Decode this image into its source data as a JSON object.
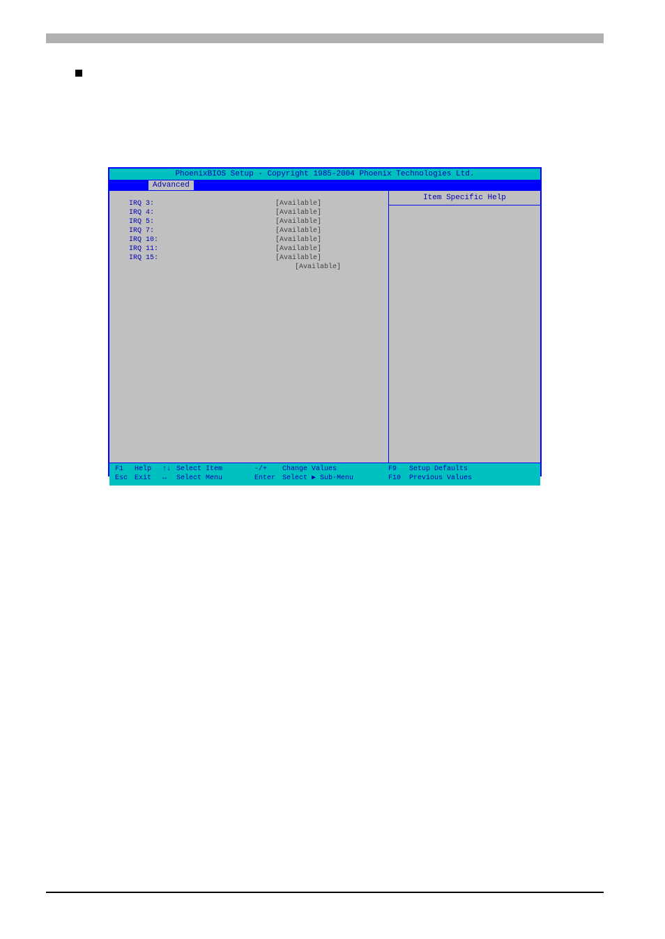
{
  "bios": {
    "title": "PhoenixBIOS Setup - Copyright 1985-2004 Phoenix Technologies Ltd.",
    "menu_tab": "Advanced",
    "help_title": "Item Specific Help",
    "irq_items": [
      {
        "label": "IRQ 3:",
        "value": "[Available]"
      },
      {
        "label": "IRQ 4:",
        "value": "[Available]"
      },
      {
        "label": "IRQ 5:",
        "value": "[Available]"
      },
      {
        "label": "IRQ 7:",
        "value": "[Available]"
      },
      {
        "label": "IRQ 10:",
        "value": "[Available]"
      },
      {
        "label": "IRQ 11:",
        "value": "[Available]"
      },
      {
        "label": "IRQ 15:",
        "value": "[Available]"
      }
    ],
    "extra_value": "[Available]",
    "footer": {
      "f1": "F1",
      "help": "Help",
      "esc": "Esc",
      "exit": "Exit",
      "updown": "↑↓",
      "select_item": "Select Item",
      "leftright": "↔",
      "select_menu": "Select Menu",
      "minusplus": "-/+",
      "change_values": "Change Values",
      "enter": "Enter",
      "select_sub": "Select ▶ Sub-Menu",
      "f9": "F9",
      "setup_defaults": "Setup Defaults",
      "f10": "F10",
      "previous_values": "Previous Values"
    }
  }
}
